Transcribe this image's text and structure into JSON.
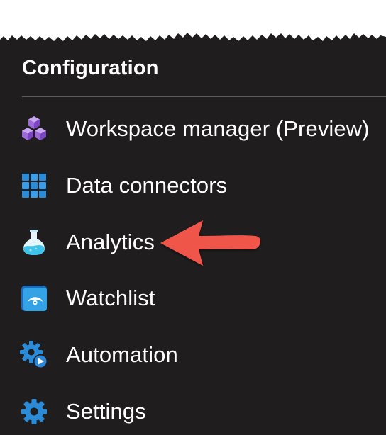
{
  "section": {
    "title": "Configuration"
  },
  "menu": {
    "items": [
      {
        "label": "Workspace manager (Preview)",
        "icon": "cubes-icon"
      },
      {
        "label": "Data connectors",
        "icon": "grid-icon"
      },
      {
        "label": "Analytics",
        "icon": "flask-icon"
      },
      {
        "label": "Watchlist",
        "icon": "eye-card-icon"
      },
      {
        "label": "Automation",
        "icon": "gear-play-icon"
      },
      {
        "label": "Settings",
        "icon": "gear-icon"
      }
    ]
  },
  "annotation": {
    "arrow_color": "#f0544a",
    "points_to": "Analytics"
  },
  "colors": {
    "background": "#1f1d1d",
    "text": "#ffffff",
    "accent_blue": "#2a8cd8",
    "accent_purple": "#8c5bd6",
    "accent_teal": "#40c8e8"
  }
}
